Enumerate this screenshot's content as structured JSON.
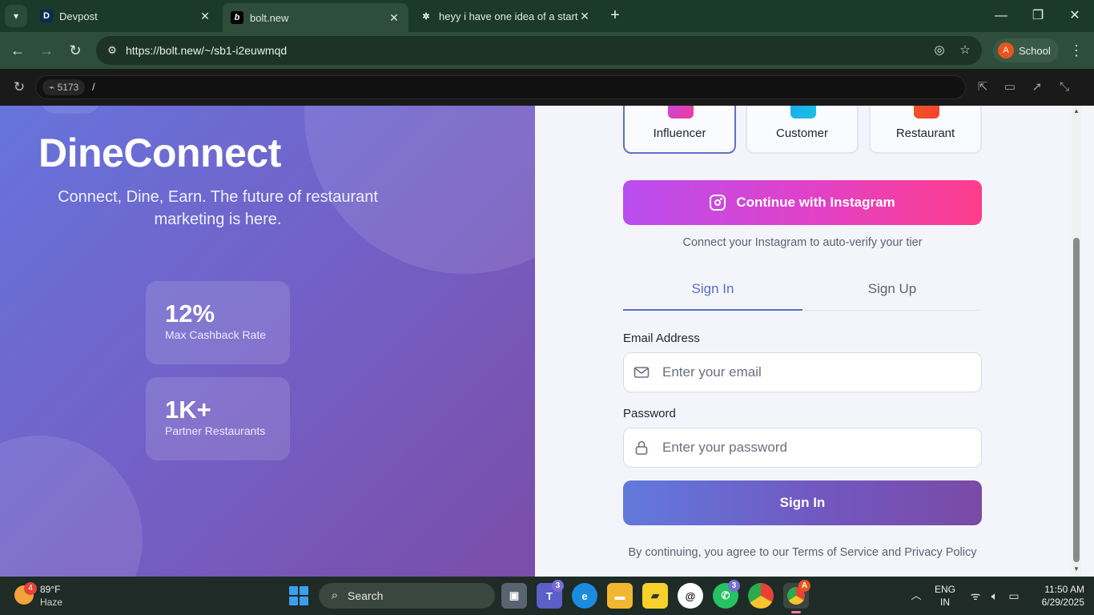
{
  "browser": {
    "tabs": [
      {
        "title": "Devpost",
        "favicon_letter": "D"
      },
      {
        "title": "bolt.new",
        "favicon_letter": "b"
      },
      {
        "title": "heyy i have one idea of a startu",
        "favicon_letter": "✲"
      }
    ],
    "url": "https://bolt.new/~/sb1-i2euwmqd",
    "profile": {
      "initial": "A",
      "label": "School"
    }
  },
  "preview": {
    "port": "5173",
    "path": "/"
  },
  "hero": {
    "title": "DineConnect",
    "tagline": "Connect, Dine, Earn. The future of restaurant marketing is here.",
    "stats": [
      {
        "value": "12%",
        "label": "Max Cashback Rate"
      },
      {
        "value": "1K+",
        "label": "Partner Restaurants"
      }
    ]
  },
  "auth": {
    "roles": [
      {
        "label": "Influencer",
        "selected": true
      },
      {
        "label": "Customer",
        "selected": false
      },
      {
        "label": "Restaurant",
        "selected": false
      }
    ],
    "instagram_button": "Continue with Instagram",
    "instagram_note": "Connect your Instagram to auto-verify your tier",
    "tabs": {
      "signin": "Sign In",
      "signup": "Sign Up"
    },
    "email_label": "Email Address",
    "email_placeholder": "Enter your email",
    "password_label": "Password",
    "password_placeholder": "Enter your password",
    "submit": "Sign In",
    "terms": "By continuing, you agree to our Terms of Service and Privacy Policy"
  },
  "taskbar": {
    "weather": {
      "temp": "89°F",
      "condition": "Haze",
      "alerts": "4"
    },
    "search": "Search",
    "teams_count": "3",
    "whatsapp_count": "3",
    "lang": {
      "line1": "ENG",
      "line2": "IN"
    },
    "time": "11:50 AM",
    "date": "6/29/2025"
  },
  "colors": {
    "accent": "#5a6cc8",
    "instagram_start": "#b84ef0",
    "instagram_end": "#ff3d8a",
    "hero_start": "#6674db",
    "hero_end": "#7b4da8"
  }
}
